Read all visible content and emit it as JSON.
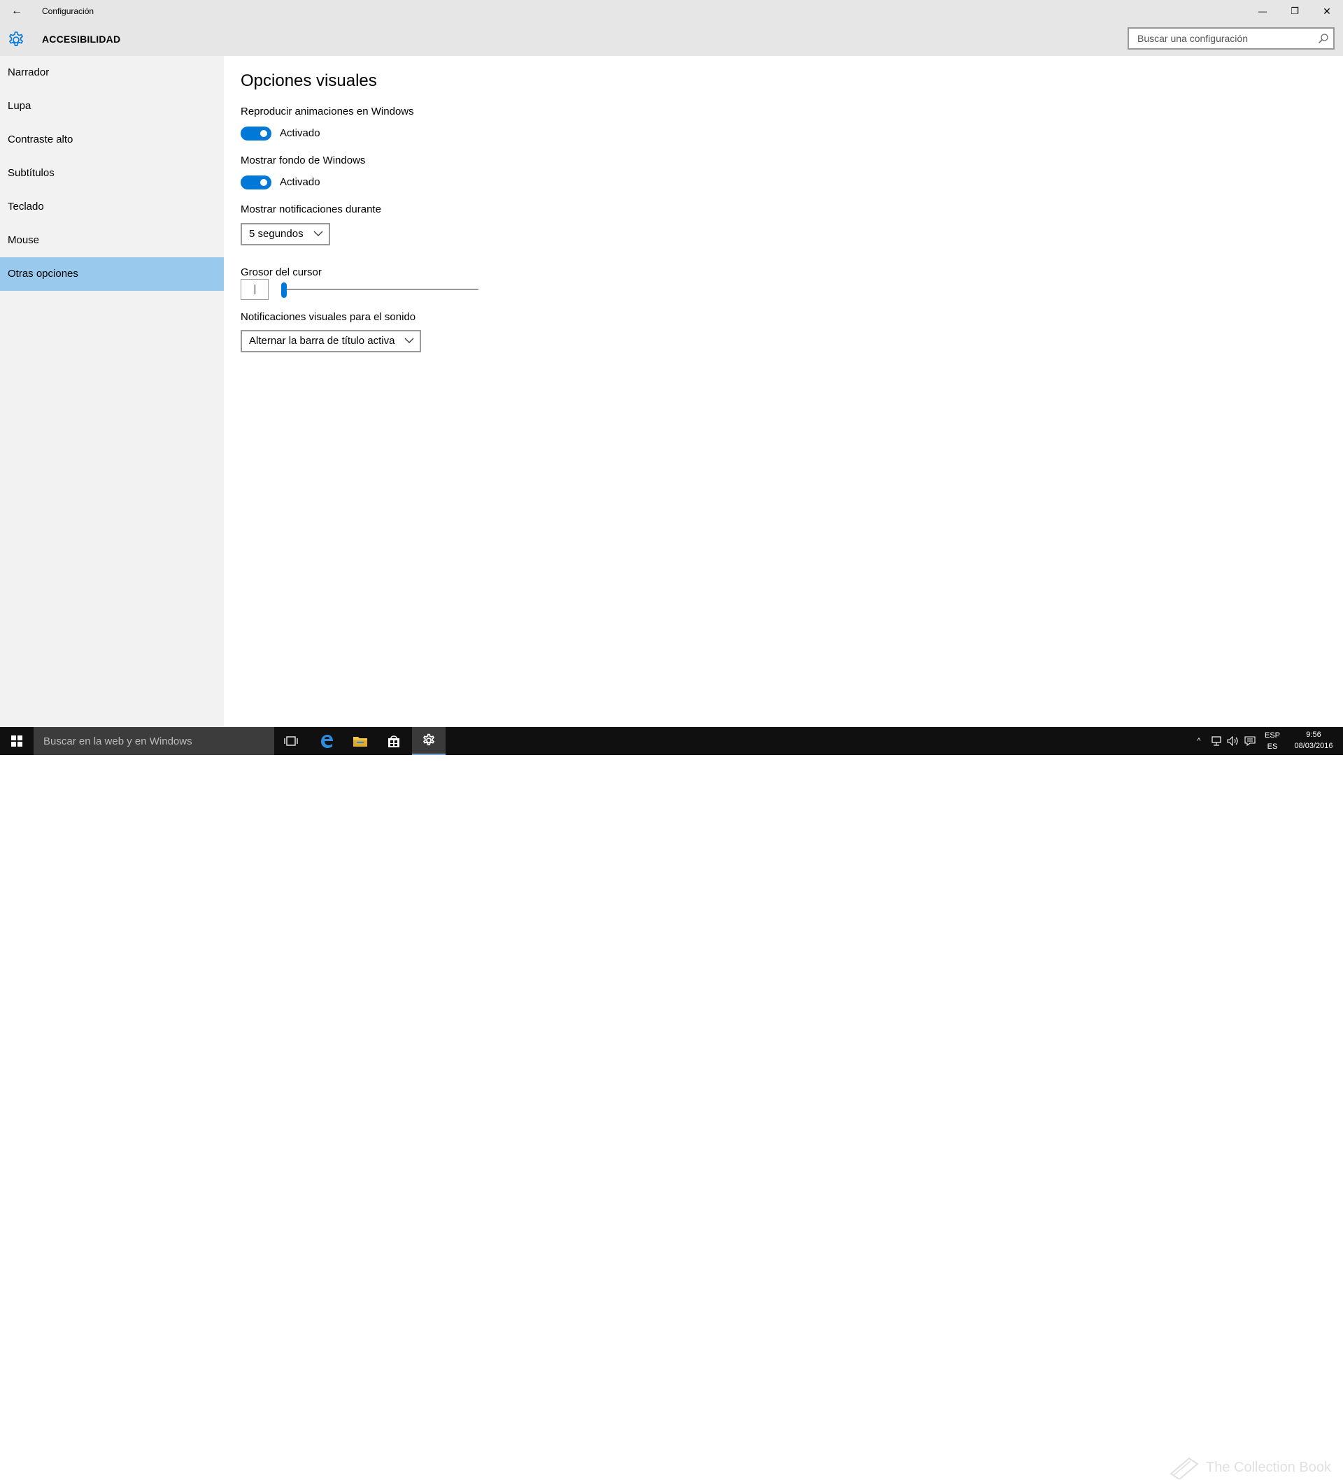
{
  "window": {
    "title": "Configuración",
    "back_glyph": "←",
    "minimize_glyph": "—",
    "maximize_glyph": "❐",
    "close_glyph": "✕"
  },
  "header": {
    "section_title": "ACCESIBILIDAD",
    "search_placeholder": "Buscar una configuración"
  },
  "sidebar": {
    "items": [
      {
        "label": "Narrador"
      },
      {
        "label": "Lupa"
      },
      {
        "label": "Contraste alto"
      },
      {
        "label": "Subtítulos"
      },
      {
        "label": "Teclado"
      },
      {
        "label": "Mouse"
      },
      {
        "label": "Otras opciones",
        "selected": true
      }
    ]
  },
  "main": {
    "page_title": "Opciones visuales",
    "animations": {
      "label": "Reproducir animaciones en Windows",
      "state": "Activado",
      "on": true
    },
    "background": {
      "label": "Mostrar fondo de Windows",
      "state": "Activado",
      "on": true
    },
    "notifications": {
      "label": "Mostrar notificaciones durante",
      "value": "5 segundos"
    },
    "cursor": {
      "label": "Grosor del cursor",
      "level": 1
    },
    "sound": {
      "label": "Notificaciones visuales para el sonido",
      "value": "Alternar la barra de título activa"
    }
  },
  "taskbar": {
    "search_placeholder": "Buscar en la web y en Windows",
    "apps": [
      "task-view-icon",
      "edge-icon",
      "file-explorer-icon",
      "store-icon",
      "settings-icon"
    ],
    "tray": {
      "language_top": "ESP",
      "language_bottom": "ES",
      "time": "9:56",
      "date": "08/03/2016"
    },
    "watermark": "The Collection Book"
  },
  "colors": {
    "accent": "#0078d7",
    "selected_item": "#99c9ec",
    "chrome": "#e6e6e6",
    "sidebar": "#f2f2f2",
    "taskbar": "#101010"
  }
}
